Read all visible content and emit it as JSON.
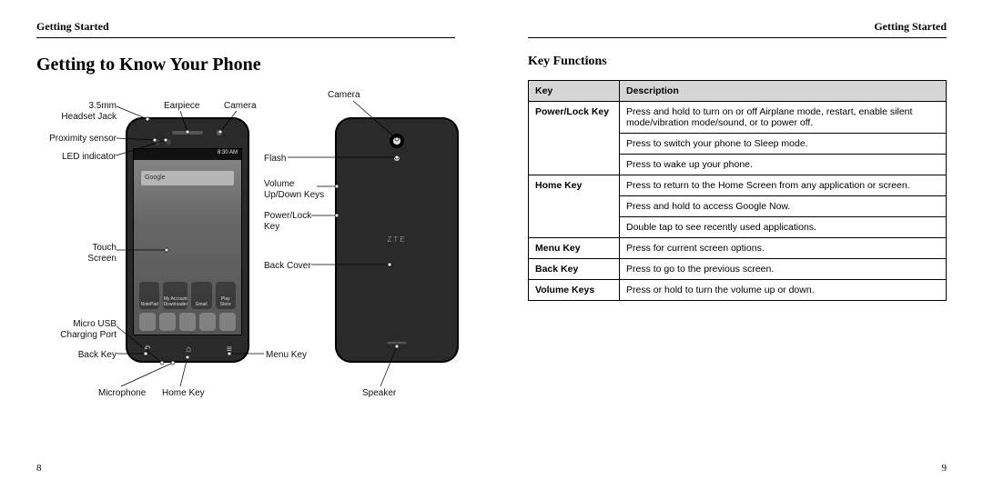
{
  "left": {
    "running_head": "Getting Started",
    "heading": "Getting to Know Your Phone",
    "page_number": "8",
    "labels": {
      "headset_jack": "3.5mm\nHeadset Jack",
      "proximity": "Proximity sensor",
      "led": "LED indicator",
      "touch_screen": "Touch\nScreen",
      "micro_usb": "Micro USB\nCharging Port",
      "back_key": "Back Key",
      "microphone": "Microphone",
      "home_key": "Home Key",
      "earpiece": "Earpiece",
      "front_camera": "Camera",
      "menu_key": "Menu Key",
      "back_camera": "Camera",
      "flash": "Flash",
      "volume_keys": "Volume\nUp/Down Keys",
      "power_key": "Power/Lock\nKey",
      "back_cover": "Back Cover",
      "speaker": "Speaker"
    },
    "screen": {
      "status_time": "8:30 AM",
      "search_placeholder": "Google",
      "app1": "NotePad",
      "app2": "My Account\nDownloader",
      "app3": "Email",
      "app4": "Play Store"
    },
    "back_logo": "ZTE"
  },
  "right": {
    "running_head": "Getting Started",
    "heading": "Key Functions",
    "page_number": "9",
    "table_header_key": "Key",
    "table_header_desc": "Description",
    "rows": [
      {
        "key": "Power/Lock Key",
        "desc": [
          "Press and hold to turn on or off Airplane mode, restart, enable silent mode/vibration mode/sound, or to power off.",
          "Press to switch your phone to Sleep mode.",
          "Press to wake up your phone."
        ]
      },
      {
        "key": "Home Key",
        "desc": [
          "Press to return to the Home Screen from any application or screen.",
          "Press and hold to access Google Now.",
          "Double tap to see recently used applications."
        ]
      },
      {
        "key": "Menu Key",
        "desc": [
          "Press for current screen options."
        ]
      },
      {
        "key": "Back Key",
        "desc": [
          "Press to go to the previous screen."
        ]
      },
      {
        "key": "Volume Keys",
        "desc": [
          "Press or hold to turn the volume up or down."
        ]
      }
    ]
  }
}
